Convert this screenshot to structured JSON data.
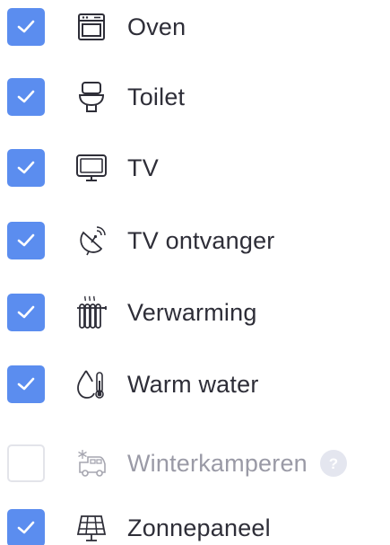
{
  "items": [
    {
      "label": "Oven",
      "checked": true,
      "icon": "oven-icon"
    },
    {
      "label": "Toilet",
      "checked": true,
      "icon": "toilet-icon"
    },
    {
      "label": "TV",
      "checked": true,
      "icon": "tv-icon"
    },
    {
      "label": "TV ontvanger",
      "checked": true,
      "icon": "satellite-dish-icon"
    },
    {
      "label": "Verwarming",
      "checked": true,
      "icon": "radiator-icon"
    },
    {
      "label": "Warm water",
      "checked": true,
      "icon": "warm-water-icon"
    },
    {
      "label": "Winterkamperen",
      "checked": false,
      "icon": "winter-camper-icon",
      "help": "?"
    },
    {
      "label": "Zonnepaneel",
      "checked": true,
      "icon": "solar-panel-icon"
    }
  ],
  "colors": {
    "checked": "#5b8def",
    "unchecked_border": "#e3e4ea",
    "text": "#2e2e38",
    "disabled_text": "#9a9aa6",
    "help_badge": "#e4e6ef"
  }
}
